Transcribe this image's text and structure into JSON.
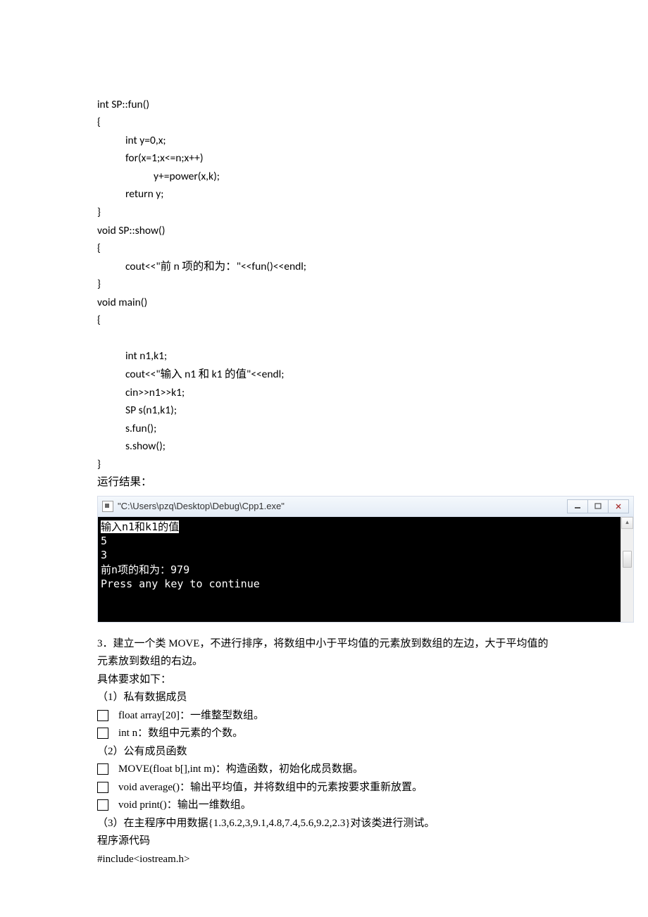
{
  "code": {
    "l1": "int SP::fun()",
    "l2": "{",
    "l3": "int y=0,x;",
    "l4": "for(x=1;x<=n;x++)",
    "l5": "y+=power(x,k);",
    "l6": "return y;",
    "l7": "}",
    "l8": "void SP::show()",
    "l9": "{",
    "l10": "cout<<\"前 n 项的和为：\"<<fun()<<endl;",
    "l11": "}",
    "l12": "void main()",
    "l13": "{",
    "blank": "",
    "l14": "int n1,k1;",
    "l15": "cout<<\"输入 n1 和 k1 的值\"<<endl;",
    "l16": "cin>>n1>>k1;",
    "l17": "SP s(n1,k1);",
    "l18": "s.fun();",
    "l19": "s.show();",
    "l20": "}",
    "result_label": "运行结果："
  },
  "console": {
    "title": "\"C:\\Users\\pzq\\Desktop\\Debug\\Cpp1.exe\"",
    "line1": "输入n1和k1的值",
    "line2": "5",
    "line3": "3",
    "line4": "前n项的和为：979",
    "line5": "Press any key to continue"
  },
  "problem": {
    "p1": "3．建立一个类 MOVE，不进行排序，将数组中小于平均值的元素放到数组的左边，大于平均值的元素放到数组的右边。",
    "p2": "具体要求如下：",
    "p3": "（1）私有数据成员",
    "li1": "float array[20]：一维整型数组。",
    "li2": "int n：数组中元素的个数。",
    "p4": "（2）公有成员函数",
    "li3": "MOVE(float b[],int m)：构造函数，初始化成员数据。",
    "li4": "void average()：输出平均值，并将数组中的元素按要求重新放置。",
    "li5": "void print()：输出一维数组。",
    "p5": "（3）在主程序中用数据{1.3,6.2,3,9.1,4.8,7.4,5.6,9.2,2.3}对该类进行测试。",
    "p6": "程序源代码",
    "p7": "#include<iostream.h>"
  }
}
